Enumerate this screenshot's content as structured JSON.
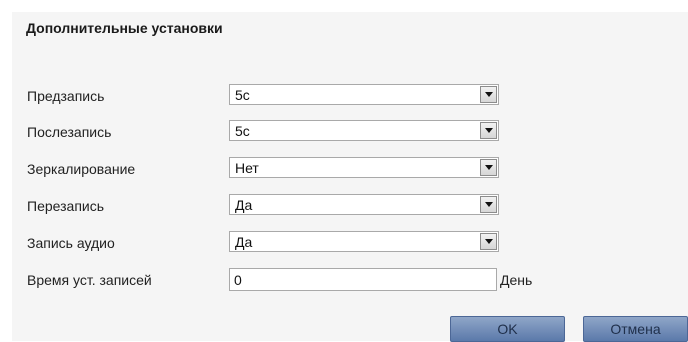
{
  "title": "Дополнительные установки",
  "rows": [
    {
      "label": "Предзапись",
      "value": "5с"
    },
    {
      "label": "Послезапись",
      "value": "5с"
    },
    {
      "label": "Зеркалирование",
      "value": "Нет"
    },
    {
      "label": "Перезапись",
      "value": "Да"
    },
    {
      "label": "Запись аудио",
      "value": "Да"
    }
  ],
  "retention": {
    "label": "Время уст. записей",
    "value": "0",
    "unit": "День"
  },
  "buttons": {
    "ok": "OK",
    "cancel": "Отмена"
  },
  "colors": {
    "panel_bg": "#f5f5f5",
    "button_blue": "#6f8cb9",
    "border": "#a9a9a9"
  },
  "icons": {
    "dropdown": "chevron-down-icon"
  }
}
